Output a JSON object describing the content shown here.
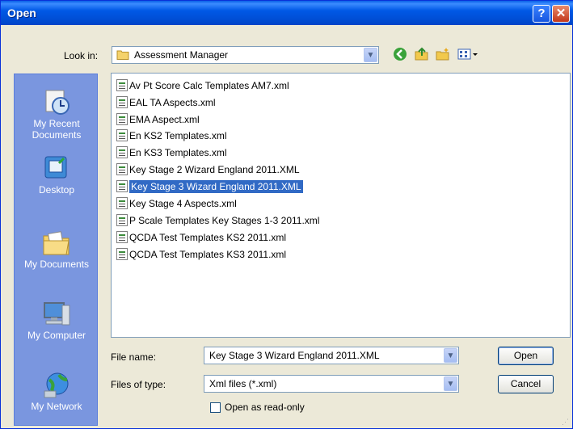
{
  "window": {
    "title": "Open"
  },
  "titlebar": {
    "help_glyph": "?",
    "close_glyph": "✕"
  },
  "look_in": {
    "label": "Look in:",
    "value": "Assessment Manager",
    "icon": "folder-icon"
  },
  "toolbar": {
    "icons": [
      "back-icon",
      "up-folder-icon",
      "new-folder-icon",
      "views-menu-icon"
    ]
  },
  "places": [
    {
      "label": "My Recent Documents",
      "icon": "recent-documents-icon"
    },
    {
      "label": "Desktop",
      "icon": "desktop-icon"
    },
    {
      "label": "My Documents",
      "icon": "my-documents-icon"
    },
    {
      "label": "My Computer",
      "icon": "my-computer-icon"
    },
    {
      "label": "My Network",
      "icon": "my-network-icon"
    }
  ],
  "files": [
    {
      "name": "Av Pt Score Calc Templates AM7.xml",
      "selected": false
    },
    {
      "name": "EAL TA Aspects.xml",
      "selected": false
    },
    {
      "name": "EMA Aspect.xml",
      "selected": false
    },
    {
      "name": "En KS2 Templates.xml",
      "selected": false
    },
    {
      "name": "En KS3 Templates.xml",
      "selected": false
    },
    {
      "name": "Key Stage 2 Wizard England 2011.XML",
      "selected": false
    },
    {
      "name": "Key Stage 3 Wizard England 2011.XML",
      "selected": true
    },
    {
      "name": "Key Stage 4 Aspects.xml",
      "selected": false
    },
    {
      "name": "P Scale Templates Key Stages 1-3 2011.xml",
      "selected": false
    },
    {
      "name": "QCDA Test Templates KS2 2011.xml",
      "selected": false
    },
    {
      "name": "QCDA Test Templates KS3 2011.xml",
      "selected": false
    }
  ],
  "file_name": {
    "label": "File name:",
    "value": "Key Stage 3 Wizard England 2011.XML"
  },
  "file_type": {
    "label": "Files of type:",
    "value": "Xml files (*.xml)"
  },
  "read_only": {
    "label": "Open as read-only",
    "checked": false
  },
  "buttons": {
    "open": "Open",
    "cancel": "Cancel"
  }
}
